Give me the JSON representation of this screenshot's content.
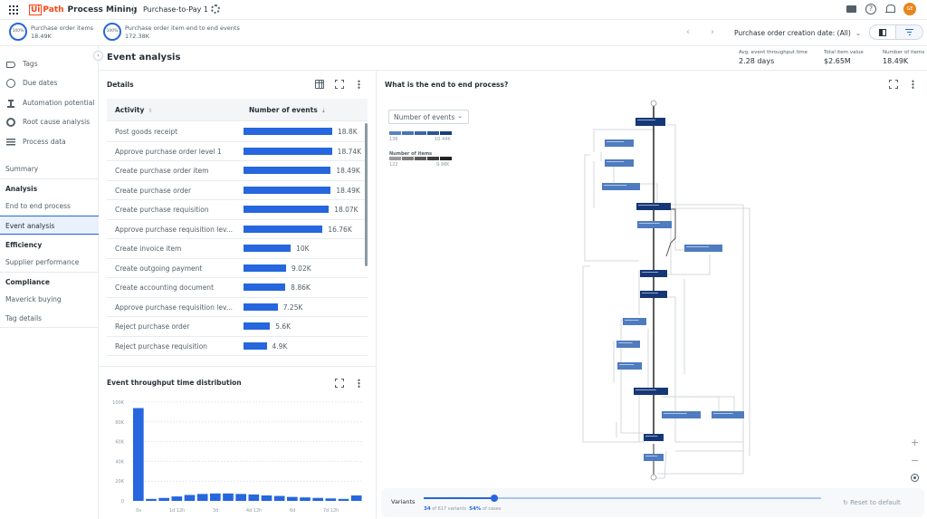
{
  "app": {
    "brand_ui": "Ui",
    "brand_path": "Path",
    "product": "Process Mining",
    "project": "Purchase-to-Pay 1",
    "avatar_initials": "GE"
  },
  "kpis": [
    {
      "percent": "100%",
      "label": "Purchase order items",
      "value": "18.49K"
    },
    {
      "percent": "100%",
      "label": "Purchase order item end to end events",
      "value": "172.38K"
    }
  ],
  "filter": {
    "date_filter": "Purchase order creation date: (All)"
  },
  "sidebar": {
    "tools": [
      {
        "label": "Tags",
        "icon": "tag-icon"
      },
      {
        "label": "Due dates",
        "icon": "timer-icon"
      },
      {
        "label": "Automation potential",
        "icon": "robot-icon"
      },
      {
        "label": "Root cause analysis",
        "icon": "root-cause-icon"
      },
      {
        "label": "Process data",
        "icon": "process-data-icon"
      }
    ],
    "summary": "Summary",
    "groups": [
      {
        "heading": "Analysis",
        "items": [
          "End to end process",
          "Event analysis"
        ]
      },
      {
        "heading": "Efficiency",
        "items": [
          "Supplier performance"
        ]
      },
      {
        "heading": "Compliance",
        "items": [
          "Maverick buying",
          "Tag details"
        ]
      }
    ],
    "active": "Event analysis"
  },
  "page": {
    "title": "Event analysis",
    "header_kpis": [
      {
        "label": "Avg. event throughput time",
        "value": "2.28 days"
      },
      {
        "label": "Total item value",
        "value": "$2.65M"
      },
      {
        "label": "Number of items",
        "value": "18.49K"
      }
    ]
  },
  "details": {
    "title": "Details",
    "columns": [
      "Activity",
      "Number of events"
    ],
    "rows": [
      {
        "activity": "Post goods receipt",
        "events": 18800,
        "label": "18.8K"
      },
      {
        "activity": "Approve purchase order level 1",
        "events": 18740,
        "label": "18.74K"
      },
      {
        "activity": "Create purchase order item",
        "events": 18490,
        "label": "18.49K"
      },
      {
        "activity": "Create purchase order",
        "events": 18490,
        "label": "18.49K"
      },
      {
        "activity": "Create purchase requisition",
        "events": 18070,
        "label": "18.07K"
      },
      {
        "activity": "Approve purchase requisition lev...",
        "events": 16760,
        "label": "16.76K"
      },
      {
        "activity": "Create invoice item",
        "events": 10000,
        "label": "10K"
      },
      {
        "activity": "Create outgoing payment",
        "events": 9020,
        "label": "9.02K"
      },
      {
        "activity": "Create accounting document",
        "events": 8860,
        "label": "8.86K"
      },
      {
        "activity": "Approve purchase requisition lev...",
        "events": 7250,
        "label": "7.25K"
      },
      {
        "activity": "Reject purchase order",
        "events": 5600,
        "label": "5.6K"
      },
      {
        "activity": "Reject purchase requisition",
        "events": 4900,
        "label": "4.9K"
      }
    ]
  },
  "chart_data": {
    "type": "bar",
    "title": "Event throughput time distribution",
    "xlabel": "",
    "ylabel": "",
    "ylim": [
      0,
      100000
    ],
    "yticks": [
      0,
      20000,
      40000,
      60000,
      80000,
      100000
    ],
    "ytick_labels": [
      "0",
      "20K",
      "40K",
      "60K",
      "80K",
      "100K"
    ],
    "xtick_labels": [
      {
        "bin": 0,
        "label": "0s"
      },
      {
        "bin": 3,
        "label": "1d 12h"
      },
      {
        "bin": 6,
        "label": "3d"
      },
      {
        "bin": 9,
        "label": "4d 12h"
      },
      {
        "bin": 12,
        "label": "6d"
      },
      {
        "bin": 15,
        "label": "7d 12h"
      }
    ],
    "values": [
      94000,
      2000,
      3000,
      4500,
      6000,
      7000,
      7500,
      7500,
      7000,
      6500,
      5500,
      5000,
      4000,
      3500,
      3000,
      2500,
      2000,
      5500
    ],
    "grid": true,
    "color": "#2666de"
  },
  "process_graph": {
    "title": "What is the end to end process?",
    "metric": "Number of events",
    "events_legend": {
      "min": "136",
      "max": "10.44K",
      "colors": [
        "#5a82c0",
        "#4a74b6",
        "#3d66a8",
        "#2c5596",
        "#1b3f7a"
      ]
    },
    "items_legend": {
      "title": "Number of items",
      "min": "122",
      "max": "9.98K",
      "colors": [
        "#9a9a9a",
        "#7d7d7d",
        "#5c5c5c",
        "#3e3e3e",
        "#222222"
      ]
    },
    "zoom_in": "+",
    "zoom_out": "−"
  },
  "variants": {
    "label": "Variants",
    "fraction": 0.177,
    "selected": "34",
    "total_text": "of 617 variants",
    "cases_pct": "54%",
    "cases_text": "of cases",
    "reset_label": "Reset to default"
  },
  "colors": {
    "accent": "#2666de",
    "brand": "#fa4616",
    "node_dark": "#163777",
    "node_light": "#4f7bbf"
  }
}
